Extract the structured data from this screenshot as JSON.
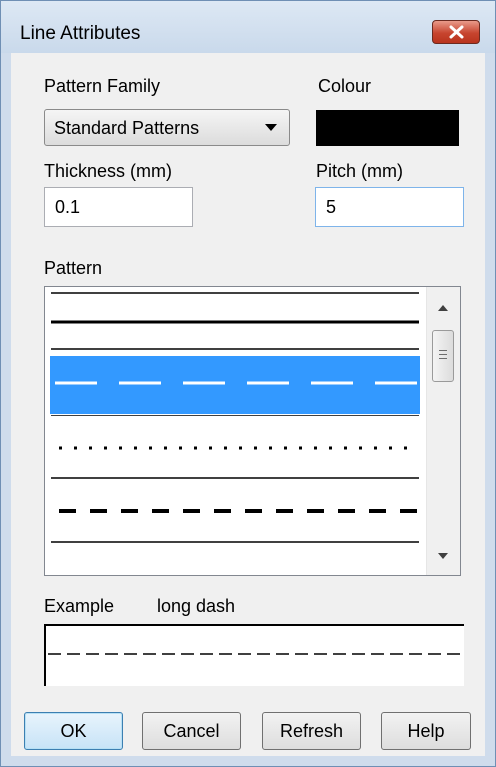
{
  "window": {
    "title": "Line Attributes"
  },
  "pattern_family": {
    "label": "Pattern Family",
    "selected": "Standard Patterns"
  },
  "colour": {
    "label": "Colour",
    "value": "#000000"
  },
  "thickness": {
    "label": "Thickness (mm)",
    "value": "0.1"
  },
  "pitch": {
    "label": "Pitch (mm)",
    "value": "5"
  },
  "pattern": {
    "label": "Pattern",
    "items": [
      {
        "style": "solid-thin",
        "selected": false
      },
      {
        "style": "solid",
        "selected": false
      },
      {
        "style": "long-dash",
        "selected": true
      },
      {
        "style": "dotted",
        "selected": false
      },
      {
        "style": "dashed",
        "selected": false
      }
    ]
  },
  "example": {
    "label": "Example",
    "pattern_name": "long dash"
  },
  "buttons": {
    "ok": "OK",
    "cancel": "Cancel",
    "refresh": "Refresh",
    "help": "Help"
  },
  "colors": {
    "selection": "#3399ff",
    "titlebar": "#cfdcec",
    "close": "#c7452f"
  }
}
